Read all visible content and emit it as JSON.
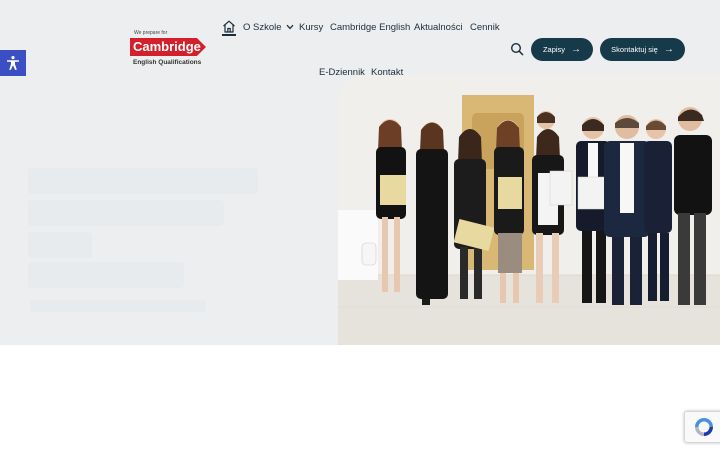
{
  "logo": {
    "small_text": "We prepare for",
    "brand": "Cambridge",
    "sub_text": "English Qualifications"
  },
  "nav": {
    "home_icon": "home-icon",
    "items": [
      "O Szkole",
      "Kursy",
      "Cambridge English",
      "Aktualności",
      "Cennik",
      "E-Dziennik",
      "Kontakt"
    ]
  },
  "actions": {
    "search_icon": "search-icon",
    "enroll_label": "Zapisy",
    "contact_label": "Skontaktuj się",
    "arrow": "→"
  },
  "accessibility_icon": "accessibility-icon",
  "recaptcha_icon": "recaptcha-icon",
  "colors": {
    "accent": "#173a4a",
    "brand_red": "#d4202a",
    "a11y_blue": "#3b4fc4",
    "hero_bg": "#eceef0"
  }
}
